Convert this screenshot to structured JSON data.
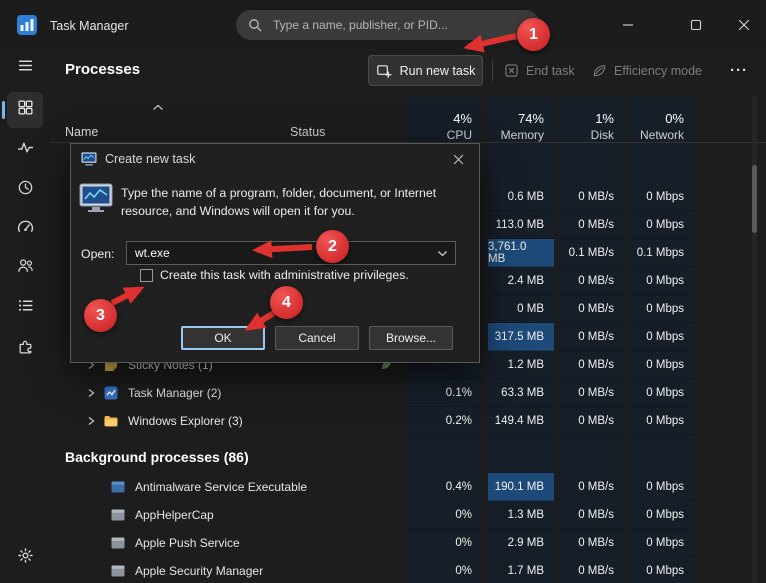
{
  "window": {
    "title": "Task Manager",
    "search_placeholder": "Type a name, publisher, or PID..."
  },
  "toolbar": {
    "title": "Processes",
    "run_new_task_label": "Run new task",
    "end_task_label": "End task",
    "efficiency_mode_label": "Efficiency mode",
    "more_label": "···"
  },
  "columns": {
    "name": "Name",
    "status": "Status",
    "cpu_pct": "4%",
    "cpu": "CPU",
    "memory_pct": "74%",
    "memory": "Memory",
    "disk_pct": "1%",
    "disk": "Disk",
    "network_pct": "0%",
    "network": "Network"
  },
  "processes": {
    "rows": [
      {
        "name": "",
        "cpu": "",
        "memory": "0.6 MB",
        "disk": "0 MB/s",
        "network": "0 Mbps"
      },
      {
        "name": "",
        "cpu": "",
        "memory": "113.0 MB",
        "disk": "0 MB/s",
        "network": "0 Mbps"
      },
      {
        "name": "",
        "cpu": "",
        "memory": "3,761.0 MB",
        "disk": "0.1 MB/s",
        "network": "0.1 Mbps",
        "hl_mem": true
      },
      {
        "name": "",
        "cpu": "",
        "memory": "2.4 MB",
        "disk": "0 MB/s",
        "network": "0 Mbps"
      },
      {
        "name": "",
        "cpu": "",
        "memory": "0 MB",
        "disk": "0 MB/s",
        "network": "0 Mbps"
      },
      {
        "name": "",
        "cpu": "",
        "memory": "317.5 MB",
        "disk": "0 MB/s",
        "network": "0 Mbps",
        "hl_mem": true
      },
      {
        "name": "Sticky Notes (1)",
        "chevron": true,
        "icon": "sticky-notes",
        "leaf": true,
        "cpu": "",
        "memory": "1.2 MB",
        "disk": "0 MB/s",
        "network": "0 Mbps"
      },
      {
        "name": "Task Manager (2)",
        "chevron": true,
        "icon": "task-manager",
        "cpu": "0.1%",
        "memory": "63.3 MB",
        "disk": "0 MB/s",
        "network": "0 Mbps"
      },
      {
        "name": "Windows Explorer (3)",
        "chevron": true,
        "icon": "folder",
        "cpu": "0.2%",
        "memory": "149.4 MB",
        "disk": "0 MB/s",
        "network": "0 Mbps"
      }
    ],
    "background_header": "Background processes (86)",
    "background_rows": [
      {
        "name": "Antimalware Service Executable",
        "icon": "window-blue",
        "cpu": "0.4%",
        "memory": "190.1 MB",
        "disk": "0 MB/s",
        "network": "0 Mbps",
        "hl_mem": true
      },
      {
        "name": "AppHelperCap",
        "icon": "window",
        "cpu": "0%",
        "memory": "1.3 MB",
        "disk": "0 MB/s",
        "network": "0 Mbps"
      },
      {
        "name": "Apple Push Service",
        "icon": "window",
        "cpu": "0%",
        "memory": "2.9 MB",
        "disk": "0 MB/s",
        "network": "0 Mbps"
      },
      {
        "name": "Apple Security Manager",
        "icon": "window",
        "cpu": "0%",
        "memory": "1.7 MB",
        "disk": "0 MB/s",
        "network": "0 Mbps"
      }
    ]
  },
  "dialog": {
    "title": "Create new task",
    "description": "Type the name of a program, folder, document, or Internet resource, and Windows will open it for you.",
    "open_label": "Open:",
    "open_value": "wt.exe",
    "admin_checkbox_label": "Create this task with administrative privileges.",
    "ok_label": "OK",
    "cancel_label": "Cancel",
    "browse_label": "Browse..."
  },
  "annotations": {
    "step1": "1",
    "step2": "2",
    "step3": "3",
    "step4": "4",
    "accent_color": "#e03131"
  },
  "colors": {
    "window_bg": "#1d1d1d",
    "stripe_bg": "#161e28",
    "cell_highlight": "#1d4a79",
    "accent_blue": "#76b9ed",
    "annotation_red": "#e03131"
  }
}
